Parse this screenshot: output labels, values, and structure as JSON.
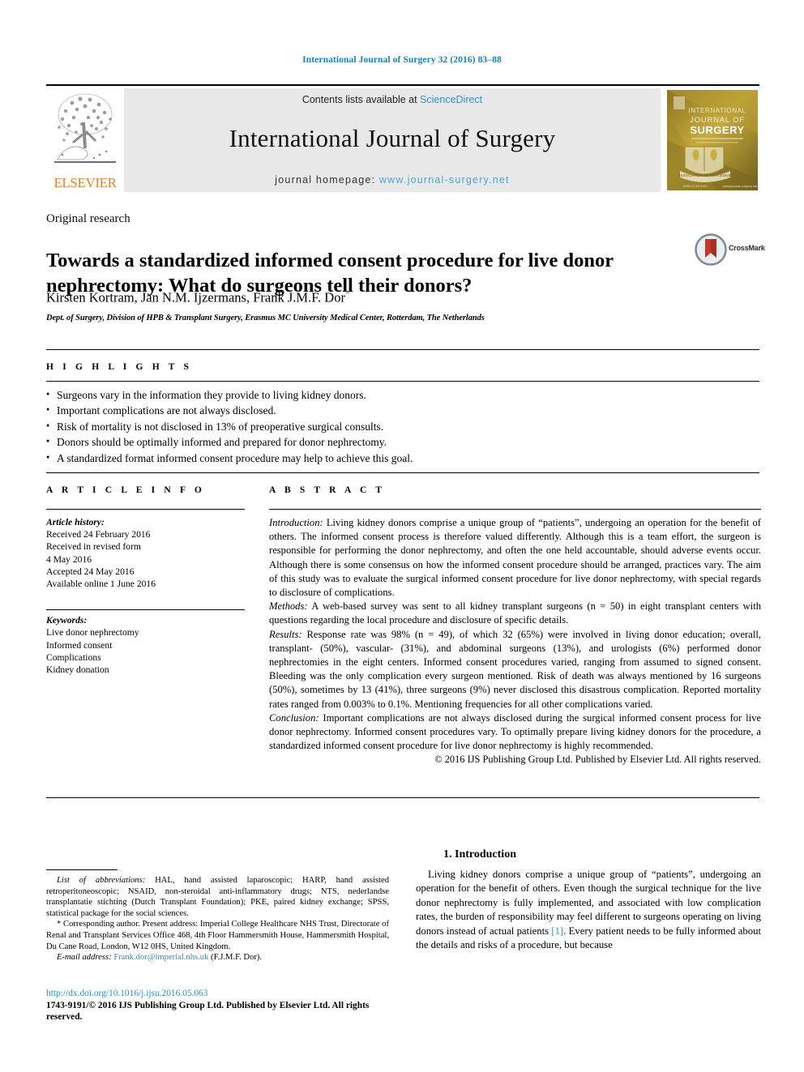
{
  "running_head": "International Journal of Surgery 32 (2016) 83–88",
  "masthead": {
    "contents_prefix": "Contents lists available at ",
    "sciencedirect": "ScienceDirect",
    "journal_title": "International Journal of Surgery",
    "homepage_prefix": "journal homepage: ",
    "homepage_url": "www.journal-surgery.net",
    "elsevier_label": "ELSEVIER",
    "cover_line1": "INTERNATIONAL",
    "cover_line2": "JOURNAL OF",
    "cover_line3": "SURGERY"
  },
  "article": {
    "type": "Original research",
    "title": "Towards a standardized informed consent procedure for live donor nephrectomy: What do surgeons tell their donors?",
    "authors": "Kirsten Kortram, Jan N.M. Ijzermans, Frank J.M.F. Dor",
    "corresponding_marker": "*",
    "affiliation": "Dept. of Surgery, Division of HPB & Transplant Surgery, Erasmus MC University Medical Center, Rotterdam, The Netherlands",
    "crossmark_label": "CrossMark"
  },
  "highlights": {
    "heading": "H I G H L I G H T S",
    "items": [
      "Surgeons vary in the information they provide to living kidney donors.",
      "Important complications are not always disclosed.",
      "Risk of mortality is not disclosed in 13% of preoperative surgical consults.",
      "Donors should be optimally informed and prepared for donor nephrectomy.",
      "A standardized format informed consent procedure may help to achieve this goal."
    ]
  },
  "article_info": {
    "heading": "A R T I C L E   I N F O",
    "history_label": "Article history:",
    "history": [
      "Received 24 February 2016",
      "Received in revised form",
      "4 May 2016",
      "Accepted 24 May 2016",
      "Available online 1 June 2016"
    ],
    "keywords_label": "Keywords:",
    "keywords": [
      "Live donor nephrectomy",
      "Informed consent",
      "Complications",
      "Kidney donation"
    ]
  },
  "abstract": {
    "heading": "A B S T R A C T",
    "introduction_label": "Introduction:",
    "introduction_text": " Living kidney donors comprise a unique group of “patients”, undergoing an operation for the benefit of others. The informed consent process is therefore valued differently. Although this is a team effort, the surgeon is responsible for performing the donor nephrectomy, and often the one held accountable, should adverse events occur. Although there is some consensus on how the informed consent procedure should be arranged, practices vary. The aim of this study was to evaluate the surgical informed consent procedure for live donor nephrectomy, with special regards to disclosure of complications.",
    "methods_label": "Methods:",
    "methods_text": " A web-based survey was sent to all kidney transplant surgeons (n = 50) in eight transplant centers with questions regarding the local procedure and disclosure of specific details.",
    "results_label": "Results:",
    "results_text": " Response rate was 98% (n = 49), of which 32 (65%) were involved in living donor education; overall, transplant- (50%), vascular- (31%), and abdominal surgeons (13%), and urologists (6%) performed donor nephrectomies in the eight centers. Informed consent procedures varied, ranging from assumed to signed consent. Bleeding was the only complication every surgeon mentioned. Risk of death was always mentioned by 16 surgeons (50%), sometimes by 13 (41%), three surgeons (9%) never disclosed this disastrous complication. Reported mortality rates ranged from 0.003% to 0.1%. Mentioning frequencies for all other complications varied.",
    "conclusion_label": "Conclusion:",
    "conclusion_text": " Important complications are not always disclosed during the surgical informed consent process for live donor nephrectomy. Informed consent procedures vary. To optimally prepare living kidney donors for the procedure, a standardized informed consent procedure for live donor nephrectomy is highly recommended.",
    "copyright": "© 2016 IJS Publishing Group Ltd. Published by Elsevier Ltd. All rights reserved."
  },
  "footnotes": {
    "abbrev_label": "List of abbreviations:",
    "abbrev_text": " HAL, hand assisted laparoscopic; HARP, hand assisted retroperitoneoscopic; NSAID, non-steroidal anti-inflammatory drugs; NTS, nederlandse transplantatie stichting (Dutch Transplant Foundation); PKE, paired kidney exchange; SPSS, statistical package for the social sciences.",
    "corresponding_marker": "*",
    "corresponding_text": " Corresponding author. Present address: Imperial College Healthcare NHS Trust, Directorate of Renal and Transplant Services Office 468, 4th Floor Hammersmith House, Hammersmith Hospital, Du Cane Road, London, W12 0HS, United Kingdom.",
    "email_label": "E-mail address:",
    "email_address": "Frank.dor@imperial.nhs.uk",
    "email_suffix": " (F.J.M.F. Dor)."
  },
  "doi": {
    "url": "http://dx.doi.org/10.1016/j.ijsu.2016.05.063",
    "issn_line": "1743-9191/© 2016 IJS Publishing Group Ltd. Published by Elsevier Ltd. All rights reserved."
  },
  "introduction": {
    "heading": "1.  Introduction",
    "paragraph_part1": "Living kidney donors comprise a unique group of “patients”, undergoing an operation for the benefit of others. Even though the surgical technique for the live donor nephrectomy is fully implemented, and associated with low complication rates, the burden of responsibility may feel different to surgeons operating on living donors instead of actual patients ",
    "reference": "[1]",
    "paragraph_part2": ". Every patient needs to be fully informed about the details and risks of a procedure, but because"
  },
  "colors": {
    "link_blue": "#2a8fc6",
    "elsevier_orange": "#ef7d22",
    "masthead_grey": "#e8e8e8"
  }
}
